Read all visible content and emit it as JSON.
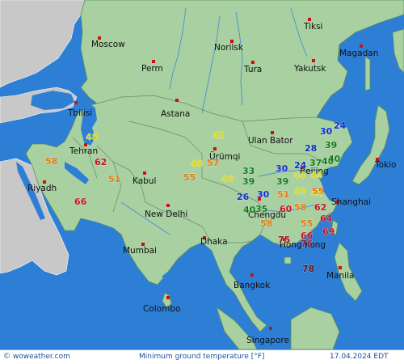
{
  "map": {
    "cities": [
      {
        "name": "Moscow"
      },
      {
        "name": "Perm"
      },
      {
        "name": "Norilsk"
      },
      {
        "name": "Tura"
      },
      {
        "name": "Tiksi"
      },
      {
        "name": "Yakutsk"
      },
      {
        "name": "Magadan"
      },
      {
        "name": "Tbilisi"
      },
      {
        "name": "Astana"
      },
      {
        "name": "Tehran"
      },
      {
        "name": "Ulan Bator"
      },
      {
        "name": "Ürümqi"
      },
      {
        "name": "Beijing"
      },
      {
        "name": "Tokio"
      },
      {
        "name": "Kabul"
      },
      {
        "name": "Riyadh"
      },
      {
        "name": "Chengdu"
      },
      {
        "name": "Shanghai"
      },
      {
        "name": "New Delhi"
      },
      {
        "name": "Dhaka"
      },
      {
        "name": "Mumbai"
      },
      {
        "name": "Hong Kong"
      },
      {
        "name": "Manila"
      },
      {
        "name": "Bangkok"
      },
      {
        "name": "Colombo"
      },
      {
        "name": "Singapore"
      }
    ],
    "temperatures": [
      {
        "value": "30",
        "color": "#0a2cc8"
      },
      {
        "value": "24",
        "color": "#0a2cc8"
      },
      {
        "value": "28",
        "color": "#0a2cc8"
      },
      {
        "value": "39",
        "color": "#0f7a1a"
      },
      {
        "value": "48",
        "color": "#d8d818"
      },
      {
        "value": "42",
        "color": "#d8d818"
      },
      {
        "value": "58",
        "color": "#e07a10"
      },
      {
        "value": "62",
        "color": "#c81020"
      },
      {
        "value": "48",
        "color": "#d8d818"
      },
      {
        "value": "57",
        "color": "#e07a10"
      },
      {
        "value": "51",
        "color": "#e07a10"
      },
      {
        "value": "55",
        "color": "#e07a10"
      },
      {
        "value": "46",
        "color": "#d8d818"
      },
      {
        "value": "33",
        "color": "#0f7a1a"
      },
      {
        "value": "39",
        "color": "#0f7a1a"
      },
      {
        "value": "30",
        "color": "#0a2cc8"
      },
      {
        "value": "24",
        "color": "#0a2cc8"
      },
      {
        "value": "37",
        "color": "#0f7a1a"
      },
      {
        "value": "40",
        "color": "#0f7a1a"
      },
      {
        "value": "44",
        "color": "#d8d818"
      },
      {
        "value": "44",
        "color": "#d8d818"
      },
      {
        "value": "40",
        "color": "#0f7a1a"
      },
      {
        "value": "39",
        "color": "#0f7a1a"
      },
      {
        "value": "49",
        "color": "#d8d818"
      },
      {
        "value": "42",
        "color": "#d8d818"
      },
      {
        "value": "55",
        "color": "#e07a10"
      },
      {
        "value": "26",
        "color": "#0a2cc8"
      },
      {
        "value": "30",
        "color": "#0a2cc8"
      },
      {
        "value": "51",
        "color": "#e07a10"
      },
      {
        "value": "40",
        "color": "#0f7a1a"
      },
      {
        "value": "35",
        "color": "#0f7a1a"
      },
      {
        "value": "60",
        "color": "#c81020"
      },
      {
        "value": "58",
        "color": "#e07a10"
      },
      {
        "value": "62",
        "color": "#c81020"
      },
      {
        "value": "58",
        "color": "#e07a10"
      },
      {
        "value": "55",
        "color": "#e07a10"
      },
      {
        "value": "64",
        "color": "#c81020"
      },
      {
        "value": "66",
        "color": "#c81020"
      },
      {
        "value": "69",
        "color": "#c81020"
      },
      {
        "value": "75",
        "color": "#a0102a"
      },
      {
        "value": "76",
        "color": "#a0102a"
      },
      {
        "value": "78",
        "color": "#5a0a1a"
      },
      {
        "value": "66",
        "color": "#c81020"
      }
    ]
  },
  "footer": {
    "copyright": "© woweather.com",
    "title": "Minimum ground temperature [°F]",
    "date": "17.04.2024 EDT"
  },
  "colors": {
    "sea": "#2d7fd6",
    "land": "#a8d0a0",
    "land_outside": "#c8c8c8",
    "border": "#6a8a6a",
    "river": "#4a90d0",
    "city_dot": "#cc1111"
  }
}
